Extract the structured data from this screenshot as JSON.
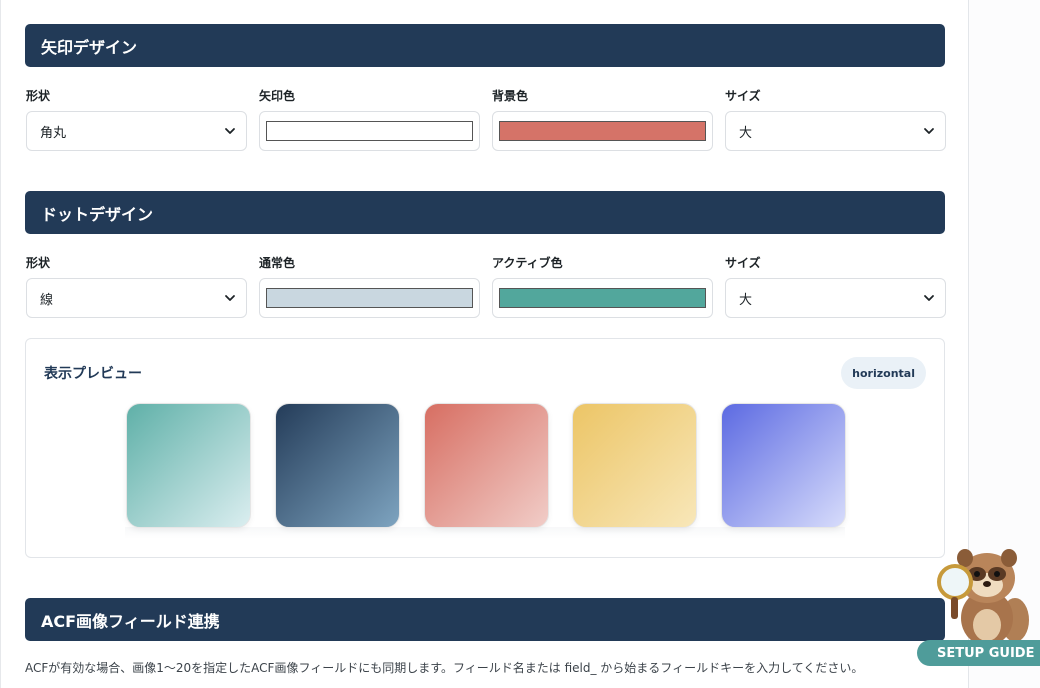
{
  "arrow_section": {
    "title": "矢印デザイン",
    "shape_label": "形状",
    "shape_value": "角丸",
    "arrow_color_label": "矢印色",
    "arrow_color": "#ffffff",
    "bg_color_label": "背景色",
    "bg_color": "#d57368",
    "size_label": "サイズ",
    "size_value": "大"
  },
  "dot_section": {
    "title": "ドットデザイン",
    "shape_label": "形状",
    "shape_value": "線",
    "normal_color_label": "通常色",
    "normal_color": "#c9d7e0",
    "active_color_label": "アクティブ色",
    "active_color": "#52a79c",
    "size_label": "サイズ",
    "size_value": "大"
  },
  "preview": {
    "title": "表示プレビュー",
    "badge": "horizontal",
    "tiles": [
      {
        "name": "teal",
        "from": "#5fb0a8",
        "to": "#dbeef0"
      },
      {
        "name": "navy",
        "from": "#243c59",
        "to": "#7ea4c0"
      },
      {
        "name": "coral",
        "from": "#d76e62",
        "to": "#f1cdc8"
      },
      {
        "name": "yellow",
        "from": "#ecc566",
        "to": "#f8e7b9"
      },
      {
        "name": "indigo",
        "from": "#5c6ae2",
        "to": "#d7dcfb"
      }
    ]
  },
  "acf_section": {
    "title": "ACF画像フィールド連携",
    "description": "ACFが有効な場合、画像1〜20を指定したACF画像フィールドにも同期します。フィールド名または field_ から始まるフィールドキーを入力してください。"
  },
  "setup_guide": {
    "label": "SETUP GUIDE M"
  }
}
